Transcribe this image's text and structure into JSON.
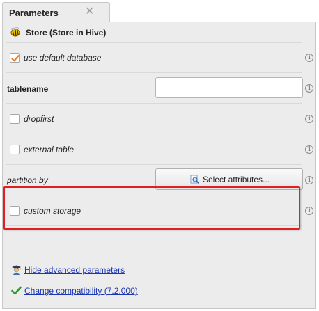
{
  "tab": {
    "title": "Parameters",
    "close_glyph": "✕"
  },
  "operator": {
    "title": "Store (Store in Hive)",
    "icon": "hive-bee-icon"
  },
  "parameters": {
    "use_default_database": {
      "label": "use default database",
      "checked": true
    },
    "tablename": {
      "label": "tablename",
      "value": ""
    },
    "dropfirst": {
      "label": "dropfirst",
      "checked": false
    },
    "external_table": {
      "label": "external table",
      "checked": false
    },
    "partition_by": {
      "label": "partition by",
      "button_label": "Select attributes..."
    },
    "custom_storage": {
      "label": "custom storage",
      "checked": false
    }
  },
  "info_glyph": "i",
  "links": {
    "hide_advanced": "Hide advanced parameters",
    "change_compatibility": "Change compatibility (7.2.000)"
  },
  "colors": {
    "highlight": "#e02020",
    "link": "#1a35b5",
    "check": "#e8761e"
  }
}
